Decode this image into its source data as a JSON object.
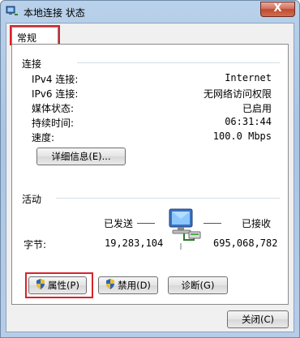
{
  "window": {
    "title": "本地连接 状态",
    "close_label": "X"
  },
  "tabs": [
    {
      "label": "常规"
    }
  ],
  "connection": {
    "heading": "连接",
    "rows": [
      {
        "label": "IPv4 连接:",
        "value": "Internet"
      },
      {
        "label": "IPv6 连接:",
        "value": "无网络访问权限"
      },
      {
        "label": "媒体状态:",
        "value": "已启用"
      },
      {
        "label": "持续时间:",
        "value": "06:31:44"
      },
      {
        "label": "速度:",
        "value": "100.0 Mbps"
      }
    ],
    "details_button": "详细信息(E)..."
  },
  "activity": {
    "heading": "活动",
    "sent_label": "已发送",
    "received_label": "已接收",
    "bytes_label": "字节:",
    "sent_bytes": "19,283,104",
    "received_bytes": "695,068,782"
  },
  "buttons": {
    "properties": "属性(P)",
    "disable": "禁用(D)",
    "diagnose": "诊断(G)",
    "close": "关闭(C)"
  },
  "icons": [
    "network-connection-icon",
    "computer-network-icon",
    "uac-shield-icon",
    "close-icon"
  ],
  "colors": {
    "highlight_box": "#d8232a",
    "title_gradient": "#b9d1ea"
  }
}
